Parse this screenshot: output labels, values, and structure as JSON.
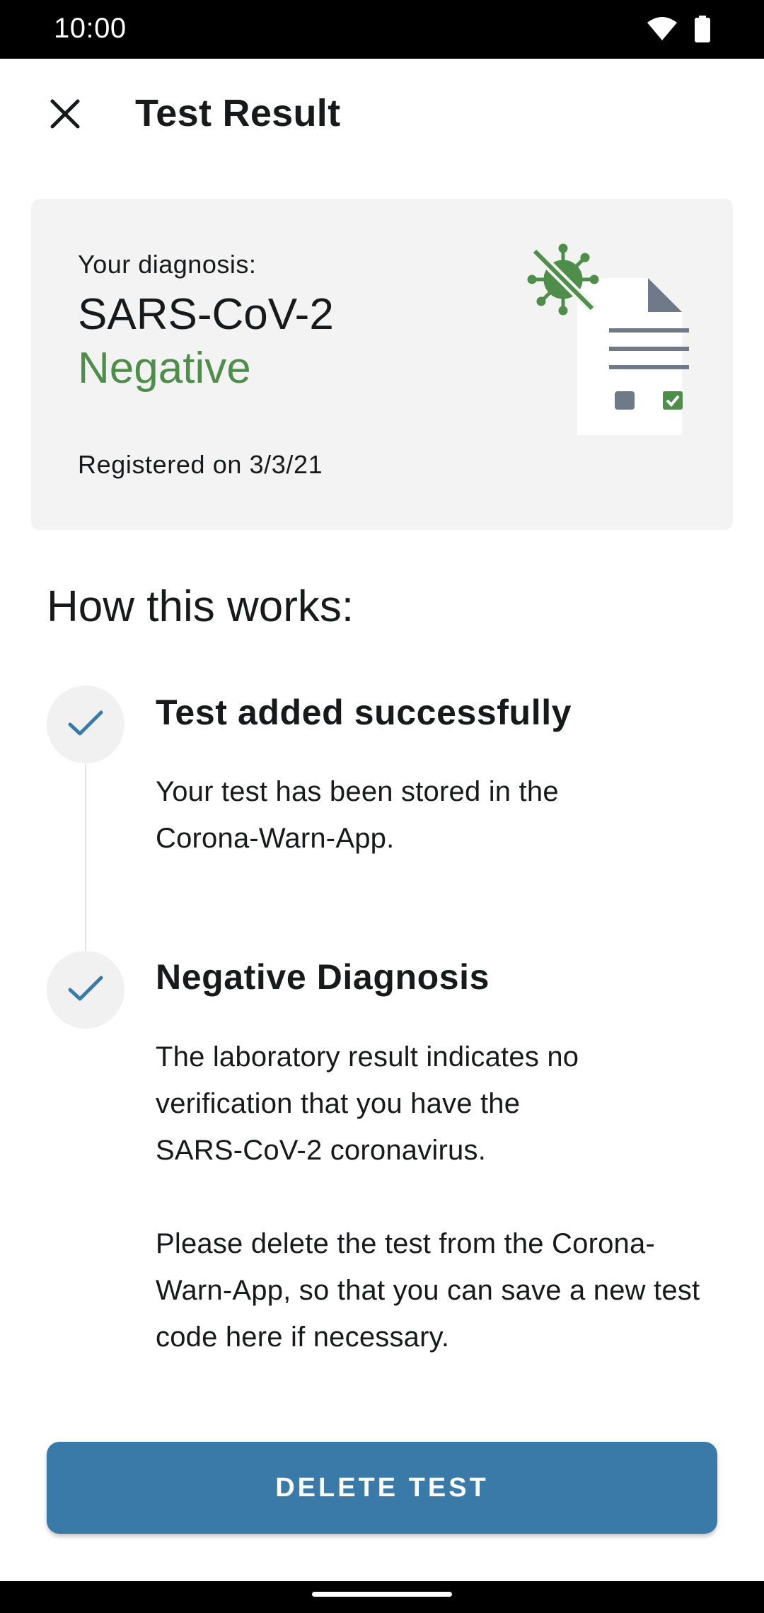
{
  "status_bar": {
    "time": "10:00",
    "icons": [
      "wifi-icon",
      "battery-icon"
    ]
  },
  "app_bar": {
    "close_icon": "close-icon",
    "title": "Test Result"
  },
  "result_card": {
    "caption": "Your diagnosis:",
    "diagnosis": "SARS-CoV-2",
    "result": "Negative",
    "registered": "Registered on 3/3/21",
    "illustration_icon": "virus-document-icon"
  },
  "how_it_works": {
    "title": "How this works:",
    "steps": [
      {
        "icon": "check-icon",
        "title": "Test added successfully",
        "body": "Your test has been stored in the Corona-Warn-App."
      },
      {
        "icon": "check-icon",
        "title": "Negative Diagnosis",
        "body": "The laboratory result indicates no verification that you have the SARS-CoV-2 coronavirus.",
        "body2": "Please delete the test from the Corona-Warn-App, so that you can save a new test code here if necessary."
      }
    ]
  },
  "actions": {
    "delete_label": "DELETE TEST"
  },
  "colors": {
    "accent_blue": "#3a7aa8",
    "negative_green": "#4e8d4a",
    "card_background": "#f3f3f3"
  }
}
